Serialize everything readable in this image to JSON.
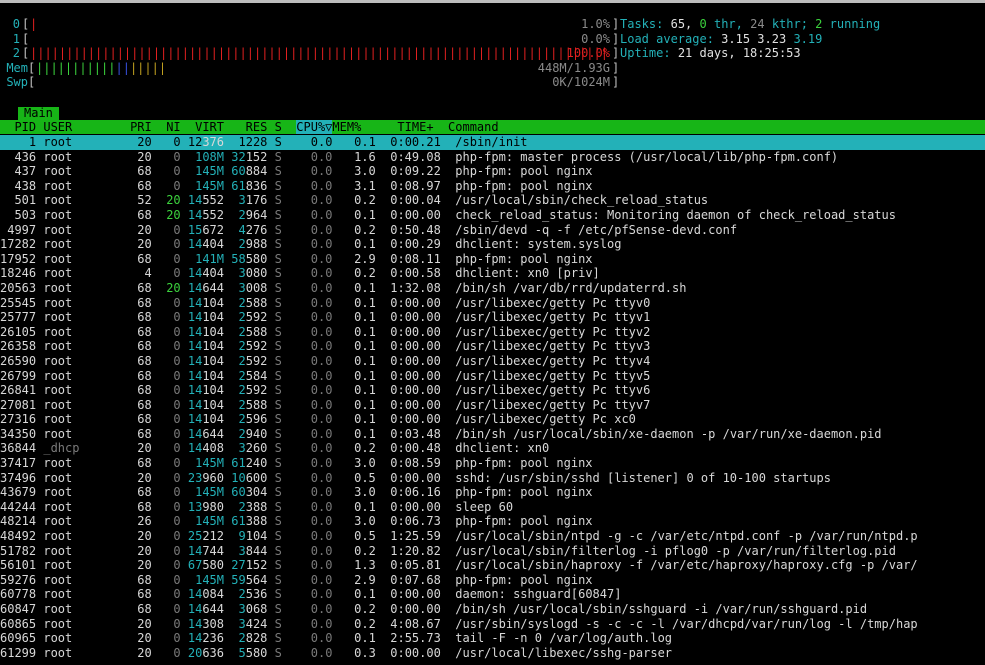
{
  "meters": {
    "cpus": [
      {
        "id": "0",
        "percent": "1.0%",
        "fill": 0.01
      },
      {
        "id": "1",
        "percent": "0.0%",
        "fill": 0.0
      },
      {
        "id": "2",
        "percent": "100.0%",
        "fill": 1.0
      }
    ],
    "mem": {
      "label": "Mem",
      "value": "448M/1.93G",
      "fill": 0.23
    },
    "swp": {
      "label": "Swp",
      "value": "0K/1024M",
      "fill": 0.0
    }
  },
  "summary": {
    "tasks_label": "Tasks:",
    "tasks": "65,",
    "thr": "0",
    "thr_label": "thr,",
    "kthr": "24",
    "kthr_label": "kthr;",
    "running": "2",
    "running_label": "running",
    "load_label": "Load average:",
    "load1": "3.15",
    "load5": "3.23",
    "load15": "3.19",
    "uptime_label": "Uptime:",
    "uptime": "21 days, 18:25:53"
  },
  "tab": "Main",
  "columns": {
    "pid": "PID",
    "user": "USER",
    "pri": "PRI",
    "ni": "NI",
    "virt": "VIRT",
    "res": "RES",
    "s": "S",
    "cpu": "CPU%",
    "sort": "▽",
    "mem": "MEM%",
    "time": "TIME+",
    "command": "Command"
  },
  "colors": {
    "cyan": "#23b1b8",
    "green": "#17b517",
    "red": "#e02020",
    "blue": "#3850e0",
    "magenta": "#b040c0"
  },
  "processes": [
    {
      "pid": "1",
      "user": "root",
      "pri": "20",
      "ni": "0",
      "virt": "12376",
      "res": "1228",
      "s": "S",
      "cpu": "0.0",
      "mem": "0.1",
      "time": "0:00.21",
      "cmd": "/sbin/init",
      "selected": true
    },
    {
      "pid": "436",
      "user": "root",
      "pri": "20",
      "ni": "0",
      "virt": "108M",
      "res": "32152",
      "s": "S",
      "cpu": "0.0",
      "mem": "1.6",
      "time": "0:49.08",
      "cmd": "php-fpm: master process (/usr/local/lib/php-fpm.conf)"
    },
    {
      "pid": "437",
      "user": "root",
      "pri": "68",
      "ni": "0",
      "virt": "145M",
      "res": "60884",
      "s": "S",
      "cpu": "0.0",
      "mem": "3.0",
      "time": "0:09.22",
      "cmd": "php-fpm: pool nginx"
    },
    {
      "pid": "438",
      "user": "root",
      "pri": "68",
      "ni": "0",
      "virt": "145M",
      "res": "61836",
      "s": "S",
      "cpu": "0.0",
      "mem": "3.1",
      "time": "0:08.97",
      "cmd": "php-fpm: pool nginx"
    },
    {
      "pid": "501",
      "user": "root",
      "pri": "52",
      "ni": "20",
      "virt": "14552",
      "res": "3176",
      "s": "S",
      "cpu": "0.0",
      "mem": "0.2",
      "time": "0:00.04",
      "cmd": "/usr/local/sbin/check_reload_status"
    },
    {
      "pid": "503",
      "user": "root",
      "pri": "68",
      "ni": "20",
      "virt": "14552",
      "res": "2964",
      "s": "S",
      "cpu": "0.0",
      "mem": "0.1",
      "time": "0:00.00",
      "cmd": "check_reload_status: Monitoring daemon of check_reload_status"
    },
    {
      "pid": "4997",
      "user": "root",
      "pri": "20",
      "ni": "0",
      "virt": "15672",
      "res": "4276",
      "s": "S",
      "cpu": "0.0",
      "mem": "0.2",
      "time": "0:50.48",
      "cmd": "/sbin/devd -q -f /etc/pfSense-devd.conf"
    },
    {
      "pid": "17282",
      "user": "root",
      "pri": "20",
      "ni": "0",
      "virt": "14404",
      "res": "2988",
      "s": "S",
      "cpu": "0.0",
      "mem": "0.1",
      "time": "0:00.29",
      "cmd": "dhclient: system.syslog"
    },
    {
      "pid": "17952",
      "user": "root",
      "pri": "68",
      "ni": "0",
      "virt": "141M",
      "res": "58580",
      "s": "S",
      "cpu": "0.0",
      "mem": "2.9",
      "time": "0:08.11",
      "cmd": "php-fpm: pool nginx"
    },
    {
      "pid": "18246",
      "user": "root",
      "pri": "4",
      "ni": "0",
      "virt": "14404",
      "res": "3080",
      "s": "S",
      "cpu": "0.0",
      "mem": "0.2",
      "time": "0:00.58",
      "cmd": "dhclient: xn0 [priv]"
    },
    {
      "pid": "20563",
      "user": "root",
      "pri": "68",
      "ni": "20",
      "virt": "14644",
      "res": "3008",
      "s": "S",
      "cpu": "0.0",
      "mem": "0.1",
      "time": "1:32.08",
      "cmd": "/bin/sh /var/db/rrd/updaterrd.sh"
    },
    {
      "pid": "25545",
      "user": "root",
      "pri": "68",
      "ni": "0",
      "virt": "14104",
      "res": "2588",
      "s": "S",
      "cpu": "0.0",
      "mem": "0.1",
      "time": "0:00.00",
      "cmd": "/usr/libexec/getty Pc ttyv0"
    },
    {
      "pid": "25777",
      "user": "root",
      "pri": "68",
      "ni": "0",
      "virt": "14104",
      "res": "2592",
      "s": "S",
      "cpu": "0.0",
      "mem": "0.1",
      "time": "0:00.00",
      "cmd": "/usr/libexec/getty Pc ttyv1"
    },
    {
      "pid": "26105",
      "user": "root",
      "pri": "68",
      "ni": "0",
      "virt": "14104",
      "res": "2588",
      "s": "S",
      "cpu": "0.0",
      "mem": "0.1",
      "time": "0:00.00",
      "cmd": "/usr/libexec/getty Pc ttyv2"
    },
    {
      "pid": "26358",
      "user": "root",
      "pri": "68",
      "ni": "0",
      "virt": "14104",
      "res": "2592",
      "s": "S",
      "cpu": "0.0",
      "mem": "0.1",
      "time": "0:00.00",
      "cmd": "/usr/libexec/getty Pc ttyv3"
    },
    {
      "pid": "26590",
      "user": "root",
      "pri": "68",
      "ni": "0",
      "virt": "14104",
      "res": "2592",
      "s": "S",
      "cpu": "0.0",
      "mem": "0.1",
      "time": "0:00.00",
      "cmd": "/usr/libexec/getty Pc ttyv4"
    },
    {
      "pid": "26799",
      "user": "root",
      "pri": "68",
      "ni": "0",
      "virt": "14104",
      "res": "2584",
      "s": "S",
      "cpu": "0.0",
      "mem": "0.1",
      "time": "0:00.00",
      "cmd": "/usr/libexec/getty Pc ttyv5"
    },
    {
      "pid": "26841",
      "user": "root",
      "pri": "68",
      "ni": "0",
      "virt": "14104",
      "res": "2592",
      "s": "S",
      "cpu": "0.0",
      "mem": "0.1",
      "time": "0:00.00",
      "cmd": "/usr/libexec/getty Pc ttyv6"
    },
    {
      "pid": "27081",
      "user": "root",
      "pri": "68",
      "ni": "0",
      "virt": "14104",
      "res": "2588",
      "s": "S",
      "cpu": "0.0",
      "mem": "0.1",
      "time": "0:00.00",
      "cmd": "/usr/libexec/getty Pc ttyv7"
    },
    {
      "pid": "27316",
      "user": "root",
      "pri": "68",
      "ni": "0",
      "virt": "14104",
      "res": "2596",
      "s": "S",
      "cpu": "0.0",
      "mem": "0.1",
      "time": "0:00.00",
      "cmd": "/usr/libexec/getty Pc xc0"
    },
    {
      "pid": "34350",
      "user": "root",
      "pri": "68",
      "ni": "0",
      "virt": "14644",
      "res": "2940",
      "s": "S",
      "cpu": "0.0",
      "mem": "0.1",
      "time": "0:03.48",
      "cmd": "/bin/sh /usr/local/sbin/xe-daemon -p /var/run/xe-daemon.pid"
    },
    {
      "pid": "36844",
      "user": "_dhcp",
      "pri": "20",
      "ni": "0",
      "virt": "14408",
      "res": "3260",
      "s": "S",
      "cpu": "0.0",
      "mem": "0.2",
      "time": "0:00.48",
      "cmd": "dhclient: xn0",
      "dimuser": true
    },
    {
      "pid": "37417",
      "user": "root",
      "pri": "68",
      "ni": "0",
      "virt": "145M",
      "res": "61240",
      "s": "S",
      "cpu": "0.0",
      "mem": "3.0",
      "time": "0:08.59",
      "cmd": "php-fpm: pool nginx"
    },
    {
      "pid": "37496",
      "user": "root",
      "pri": "20",
      "ni": "0",
      "virt": "23960",
      "res": "10600",
      "s": "S",
      "cpu": "0.0",
      "mem": "0.5",
      "time": "0:00.00",
      "cmd": "sshd: /usr/sbin/sshd [listener] 0 of 10-100 startups"
    },
    {
      "pid": "43679",
      "user": "root",
      "pri": "68",
      "ni": "0",
      "virt": "145M",
      "res": "60304",
      "s": "S",
      "cpu": "0.0",
      "mem": "3.0",
      "time": "0:06.16",
      "cmd": "php-fpm: pool nginx"
    },
    {
      "pid": "44244",
      "user": "root",
      "pri": "68",
      "ni": "0",
      "virt": "13980",
      "res": "2388",
      "s": "S",
      "cpu": "0.0",
      "mem": "0.1",
      "time": "0:00.00",
      "cmd": "sleep 60"
    },
    {
      "pid": "48214",
      "user": "root",
      "pri": "26",
      "ni": "0",
      "virt": "145M",
      "res": "61388",
      "s": "S",
      "cpu": "0.0",
      "mem": "3.0",
      "time": "0:06.73",
      "cmd": "php-fpm: pool nginx"
    },
    {
      "pid": "48492",
      "user": "root",
      "pri": "20",
      "ni": "0",
      "virt": "25212",
      "res": "9104",
      "s": "S",
      "cpu": "0.0",
      "mem": "0.5",
      "time": "1:25.59",
      "cmd": "/usr/local/sbin/ntpd -g -c /var/etc/ntpd.conf -p /var/run/ntpd.p"
    },
    {
      "pid": "51782",
      "user": "root",
      "pri": "20",
      "ni": "0",
      "virt": "14744",
      "res": "3844",
      "s": "S",
      "cpu": "0.0",
      "mem": "0.2",
      "time": "1:20.82",
      "cmd": "/usr/local/sbin/filterlog -i pflog0 -p /var/run/filterlog.pid"
    },
    {
      "pid": "56101",
      "user": "root",
      "pri": "20",
      "ni": "0",
      "virt": "67580",
      "res": "27152",
      "s": "S",
      "cpu": "0.0",
      "mem": "1.3",
      "time": "0:05.81",
      "cmd": "/usr/local/sbin/haproxy -f /var/etc/haproxy/haproxy.cfg -p /var/"
    },
    {
      "pid": "59276",
      "user": "root",
      "pri": "68",
      "ni": "0",
      "virt": "145M",
      "res": "59564",
      "s": "S",
      "cpu": "0.0",
      "mem": "2.9",
      "time": "0:07.68",
      "cmd": "php-fpm: pool nginx"
    },
    {
      "pid": "60778",
      "user": "root",
      "pri": "68",
      "ni": "0",
      "virt": "14084",
      "res": "2536",
      "s": "S",
      "cpu": "0.0",
      "mem": "0.1",
      "time": "0:00.00",
      "cmd": "daemon: sshguard[60847]"
    },
    {
      "pid": "60847",
      "user": "root",
      "pri": "68",
      "ni": "0",
      "virt": "14644",
      "res": "3068",
      "s": "S",
      "cpu": "0.0",
      "mem": "0.2",
      "time": "0:00.00",
      "cmd": "/bin/sh /usr/local/sbin/sshguard -i /var/run/sshguard.pid"
    },
    {
      "pid": "60865",
      "user": "root",
      "pri": "20",
      "ni": "0",
      "virt": "14308",
      "res": "3424",
      "s": "S",
      "cpu": "0.0",
      "mem": "0.2",
      "time": "4:08.67",
      "cmd": "/usr/sbin/syslogd -s -c -c -l /var/dhcpd/var/run/log -l /tmp/hap"
    },
    {
      "pid": "60965",
      "user": "root",
      "pri": "20",
      "ni": "0",
      "virt": "14236",
      "res": "2828",
      "s": "S",
      "cpu": "0.0",
      "mem": "0.1",
      "time": "2:55.73",
      "cmd": "tail -F -n 0 /var/log/auth.log"
    },
    {
      "pid": "61299",
      "user": "root",
      "pri": "20",
      "ni": "0",
      "virt": "20636",
      "res": "5580",
      "s": "S",
      "cpu": "0.0",
      "mem": "0.3",
      "time": "0:00.00",
      "cmd": "/usr/local/libexec/sshg-parser"
    }
  ]
}
